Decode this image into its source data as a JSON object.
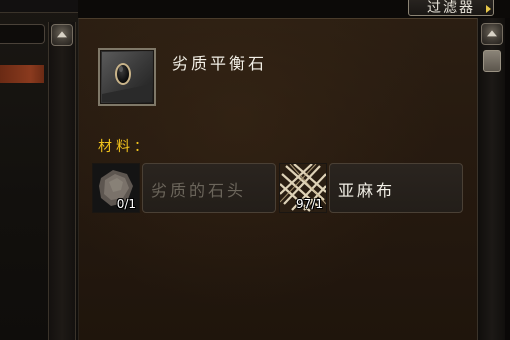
{
  "filter_button": {
    "label": "过滤器"
  },
  "item": {
    "name": "劣质平衡石",
    "icon": "balance-stone-icon"
  },
  "reagents_label": "材料：",
  "reagents": [
    {
      "name": "劣质的石头",
      "count": "0/1",
      "available": false,
      "icon": "stone-icon",
      "name_color": "#6b655b"
    },
    {
      "name": "亚麻布",
      "count": "97/1",
      "available": true,
      "icon": "linen-cloth-icon",
      "name_color": "#f2efe6"
    }
  ]
}
